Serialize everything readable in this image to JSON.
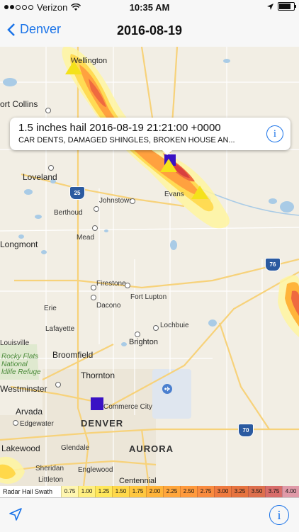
{
  "status": {
    "carrier": "Verizon",
    "time": "10:35 AM"
  },
  "nav": {
    "back_label": "Denver",
    "title": "2016-08-19"
  },
  "callout": {
    "title": "1.5 inches hail 2016-08-19 21:21:00 +0000",
    "subtitle": "CAR DENTS, DAMAGED SHINGLES, BROKEN HOUSE AN..."
  },
  "map": {
    "labels": {
      "wellington": "Wellington",
      "fort_collins": "ort Collins",
      "loveland": "Loveland",
      "johnstown": "Johnstown",
      "evans": "Evans",
      "berthoud": "Berthoud",
      "mead": "Mead",
      "longmont": "Longmont",
      "firestone": "Firestone",
      "fort_lupton": "Fort Lupton",
      "dacono": "Dacono",
      "erie": "Erie",
      "lochbuie": "Lochbuie",
      "lafayette": "Lafayette",
      "brighton": "Brighton",
      "louisville": "Louisville",
      "broomfield": "Broomfield",
      "park": "Rocky Flats\nNational\nldlife Refuge",
      "thornton": "Thornton",
      "westminster": "Westminster",
      "arvada": "Arvada",
      "commerce_city": "Commerce City",
      "edgewater": "Edgewater",
      "denver": "DENVER",
      "aurora": "AURORA",
      "lakewood": "Lakewood",
      "glendale": "Glendale",
      "sheridan": "Sheridan",
      "englewood": "Englewood",
      "littleton": "Littleton",
      "centennial": "Centennial"
    },
    "shields": {
      "i25": "25",
      "i76": "76",
      "i70": "70"
    }
  },
  "legend": {
    "title": "Radar Hail Swath",
    "values": [
      "0.75",
      "1.00",
      "1.25",
      "1.50",
      "1.75",
      "2.00",
      "2.25",
      "2.50",
      "2.75",
      "3.00",
      "3.25",
      "3.50",
      "3.75",
      "4.00"
    ],
    "colors": [
      "#fff6b0",
      "#ffef80",
      "#ffe75a",
      "#ffd84a",
      "#ffc73f",
      "#ffb43a",
      "#ffa63c",
      "#ff9a3d",
      "#f98b3f",
      "#ef7a3f",
      "#e6733f",
      "#dd6f4d",
      "#d86d6a",
      "#e09aa8"
    ]
  }
}
